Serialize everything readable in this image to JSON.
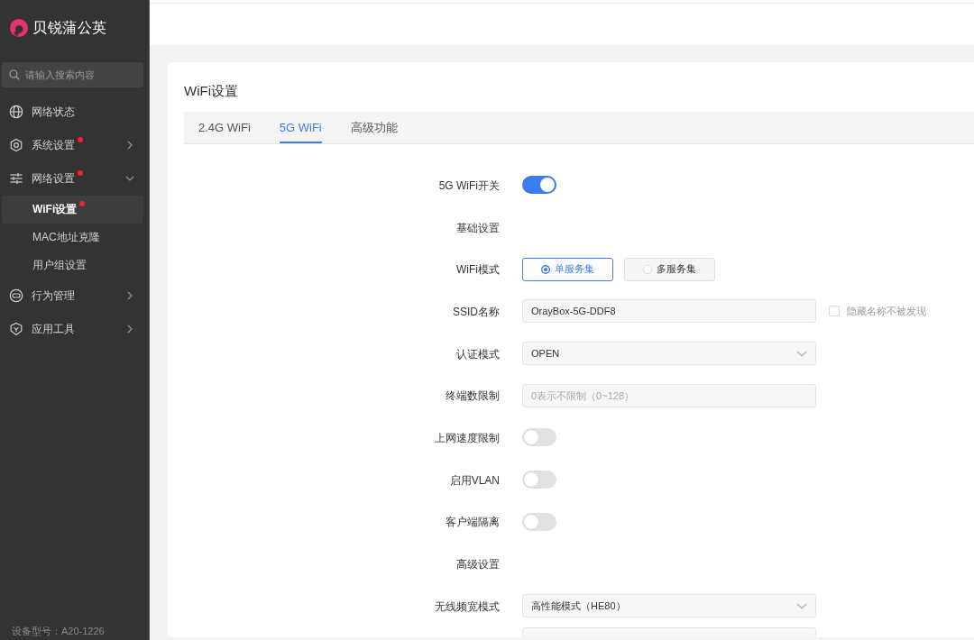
{
  "sidebar": {
    "brand": "贝锐蒲公英",
    "search": {
      "placeholder": "请输入搜索内容"
    },
    "items": [
      {
        "kind": "link",
        "label": "网络状态",
        "alert": false,
        "selected": false
      },
      {
        "kind": "group",
        "label": "系统设置",
        "alert": true,
        "selected": false,
        "expanded": false
      },
      {
        "kind": "group",
        "label": "网络设置",
        "alert": true,
        "selected": false,
        "expanded": true,
        "children": [
          {
            "label": "WiFi设置",
            "alert": true,
            "selected": true
          },
          {
            "label": "MAC地址克隆",
            "alert": false,
            "selected": false
          },
          {
            "label": "用户组设置",
            "alert": false,
            "selected": false
          }
        ]
      },
      {
        "kind": "group",
        "label": "行为管理",
        "alert": false,
        "selected": false,
        "expanded": false
      },
      {
        "kind": "group",
        "label": "应用工具",
        "alert": false,
        "selected": false,
        "expanded": false
      }
    ],
    "device_model": "设备型号：A20-1226"
  },
  "page": {
    "title": "WiFi设置",
    "tabs": [
      {
        "label": "2.4G WiFi",
        "selected": false
      },
      {
        "label": "5G WiFi",
        "selected": true
      },
      {
        "label": "高级功能",
        "selected": false
      }
    ]
  },
  "form": [
    {
      "kind": "switch",
      "label": "5G WiFi开关",
      "on": true
    },
    {
      "kind": "section",
      "label": "基础设置"
    },
    {
      "kind": "radio",
      "label": "WiFi模式",
      "options": [
        {
          "label": "单服务集",
          "selected": true
        },
        {
          "label": "多服务集",
          "selected": false
        }
      ]
    },
    {
      "kind": "input",
      "label": "SSID名称",
      "value": "OrayBox-5G-DDF8",
      "checkbox": {
        "label": "隐藏名称不被发现",
        "checked": false
      }
    },
    {
      "kind": "select",
      "label": "认证模式",
      "value": "OPEN"
    },
    {
      "kind": "input",
      "label": "终端数限制",
      "placeholder": "0表示不限制（0~128）"
    },
    {
      "kind": "switch",
      "label": "上网速度限制",
      "on": false
    },
    {
      "kind": "switch",
      "label": "启用VLAN",
      "on": false
    },
    {
      "kind": "switch",
      "label": "客户端隔离",
      "on": false
    },
    {
      "kind": "section",
      "label": "高级设置"
    },
    {
      "kind": "select",
      "label": "无线频宽模式",
      "value": "高性能模式（HE80）"
    },
    {
      "kind": "input"
    }
  ]
}
